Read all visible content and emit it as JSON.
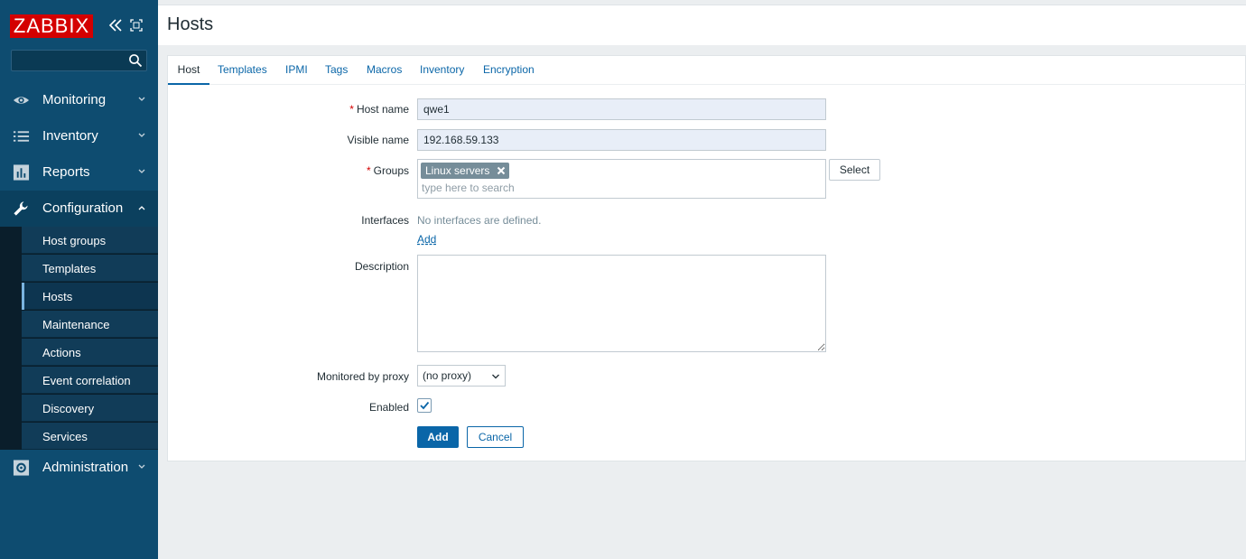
{
  "app": {
    "logo_text": "ZABBIX"
  },
  "sidebar": {
    "search": {
      "value": "",
      "placeholder": ""
    },
    "menu": [
      {
        "label": "Monitoring",
        "icon": "eye-icon"
      },
      {
        "label": "Inventory",
        "icon": "list-icon"
      },
      {
        "label": "Reports",
        "icon": "bar-chart-icon"
      },
      {
        "label": "Configuration",
        "icon": "wrench-icon"
      },
      {
        "label": "Administration",
        "icon": "gear-icon"
      }
    ],
    "configuration_submenu": [
      "Host groups",
      "Templates",
      "Hosts",
      "Maintenance",
      "Actions",
      "Event correlation",
      "Discovery",
      "Services"
    ],
    "active_submenu": "Hosts"
  },
  "header": {
    "title": "Hosts"
  },
  "tabs": [
    "Host",
    "Templates",
    "IPMI",
    "Tags",
    "Macros",
    "Inventory",
    "Encryption"
  ],
  "active_tab": "Host",
  "form": {
    "host_name": {
      "label": "Host name",
      "value": "qwe1",
      "required": true
    },
    "visible_name": {
      "label": "Visible name",
      "value": "192.168.59.133"
    },
    "groups": {
      "label": "Groups",
      "required": true,
      "chips": [
        "Linux servers"
      ],
      "placeholder": "type here to search",
      "select_label": "Select"
    },
    "interfaces": {
      "label": "Interfaces",
      "empty_text": "No interfaces are defined.",
      "add_label": "Add"
    },
    "description": {
      "label": "Description",
      "value": ""
    },
    "proxy": {
      "label": "Monitored by proxy",
      "value": "(no proxy)"
    },
    "enabled": {
      "label": "Enabled",
      "checked": true
    },
    "buttons": {
      "add": "Add",
      "cancel": "Cancel"
    }
  },
  "colors": {
    "sidebar": "#0e4c70",
    "brand_red": "#d40000",
    "link": "#0a66a8",
    "chip": "#768d99"
  }
}
